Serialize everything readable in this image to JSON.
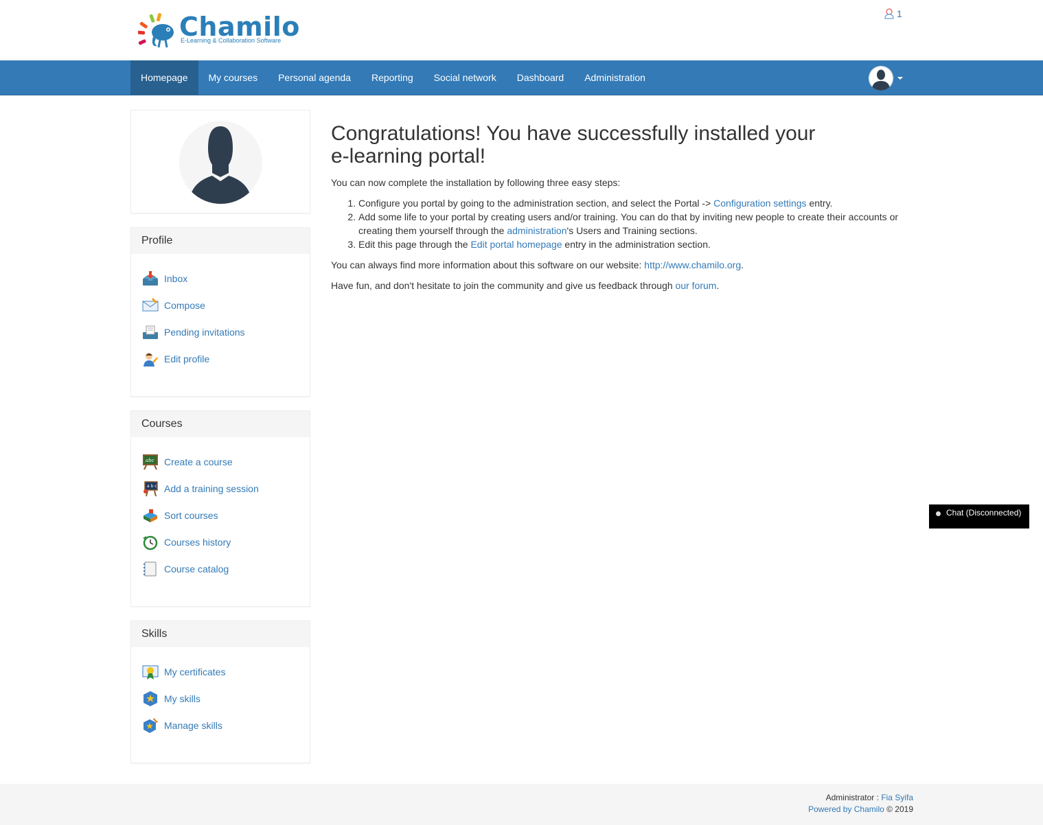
{
  "header": {
    "logo_text": "Chamilo",
    "logo_subtitle": "E-Learning & Collaboration Software",
    "notification_count": "1"
  },
  "nav": {
    "items": [
      {
        "label": "Homepage"
      },
      {
        "label": "My courses"
      },
      {
        "label": "Personal agenda"
      },
      {
        "label": "Reporting"
      },
      {
        "label": "Social network"
      },
      {
        "label": "Dashboard"
      },
      {
        "label": "Administration"
      }
    ]
  },
  "sidebar": {
    "profile": {
      "title": "Profile",
      "items": [
        {
          "label": "Inbox",
          "icon": "inbox-icon"
        },
        {
          "label": "Compose",
          "icon": "compose-icon"
        },
        {
          "label": "Pending invitations",
          "icon": "invitations-icon"
        },
        {
          "label": "Edit profile",
          "icon": "edit-profile-icon"
        }
      ]
    },
    "courses": {
      "title": "Courses",
      "items": [
        {
          "label": "Create a course",
          "icon": "create-course-icon"
        },
        {
          "label": "Add a training session",
          "icon": "training-session-icon"
        },
        {
          "label": "Sort courses",
          "icon": "sort-courses-icon"
        },
        {
          "label": "Courses history",
          "icon": "history-icon"
        },
        {
          "label": "Course catalog",
          "icon": "catalog-icon"
        }
      ]
    },
    "skills": {
      "title": "Skills",
      "items": [
        {
          "label": "My certificates",
          "icon": "certificate-icon"
        },
        {
          "label": "My skills",
          "icon": "skills-icon"
        },
        {
          "label": "Manage skills",
          "icon": "manage-skills-icon"
        }
      ]
    }
  },
  "main": {
    "title": "Congratulations! You have successfully installed your e-learning portal!",
    "intro": "You can now complete the installation by following three easy steps:",
    "step1_a": "Configure you portal by going to the administration section, and select the Portal -> ",
    "step1_link": "Configuration settings",
    "step1_b": " entry.",
    "step2_a": "Add some life to your portal by creating users and/or training. You can do that by inviting new people to create their accounts or creating them yourself through the ",
    "step2_link": "administration",
    "step2_b": "'s Users and Training sections.",
    "step3_a": "Edit this page through the ",
    "step3_link": "Edit portal homepage",
    "step3_b": " entry in the administration section.",
    "info_a": "You can always find more information about this software on our website: ",
    "info_link": "http://www.chamilo.org",
    "info_b": ".",
    "fun_a": "Have fun, and don't hesitate to join the community and give us feedback through ",
    "fun_link": "our forum",
    "fun_b": "."
  },
  "chat": {
    "label": "Chat (Disconnected)"
  },
  "footer": {
    "admin_label": "Administrator : ",
    "admin_name": "Fia Syifa",
    "powered_link": "Powered by Chamilo",
    "copyright": " © 2019"
  },
  "colors": {
    "brand": "#337ab7",
    "brand_active": "#286090"
  }
}
